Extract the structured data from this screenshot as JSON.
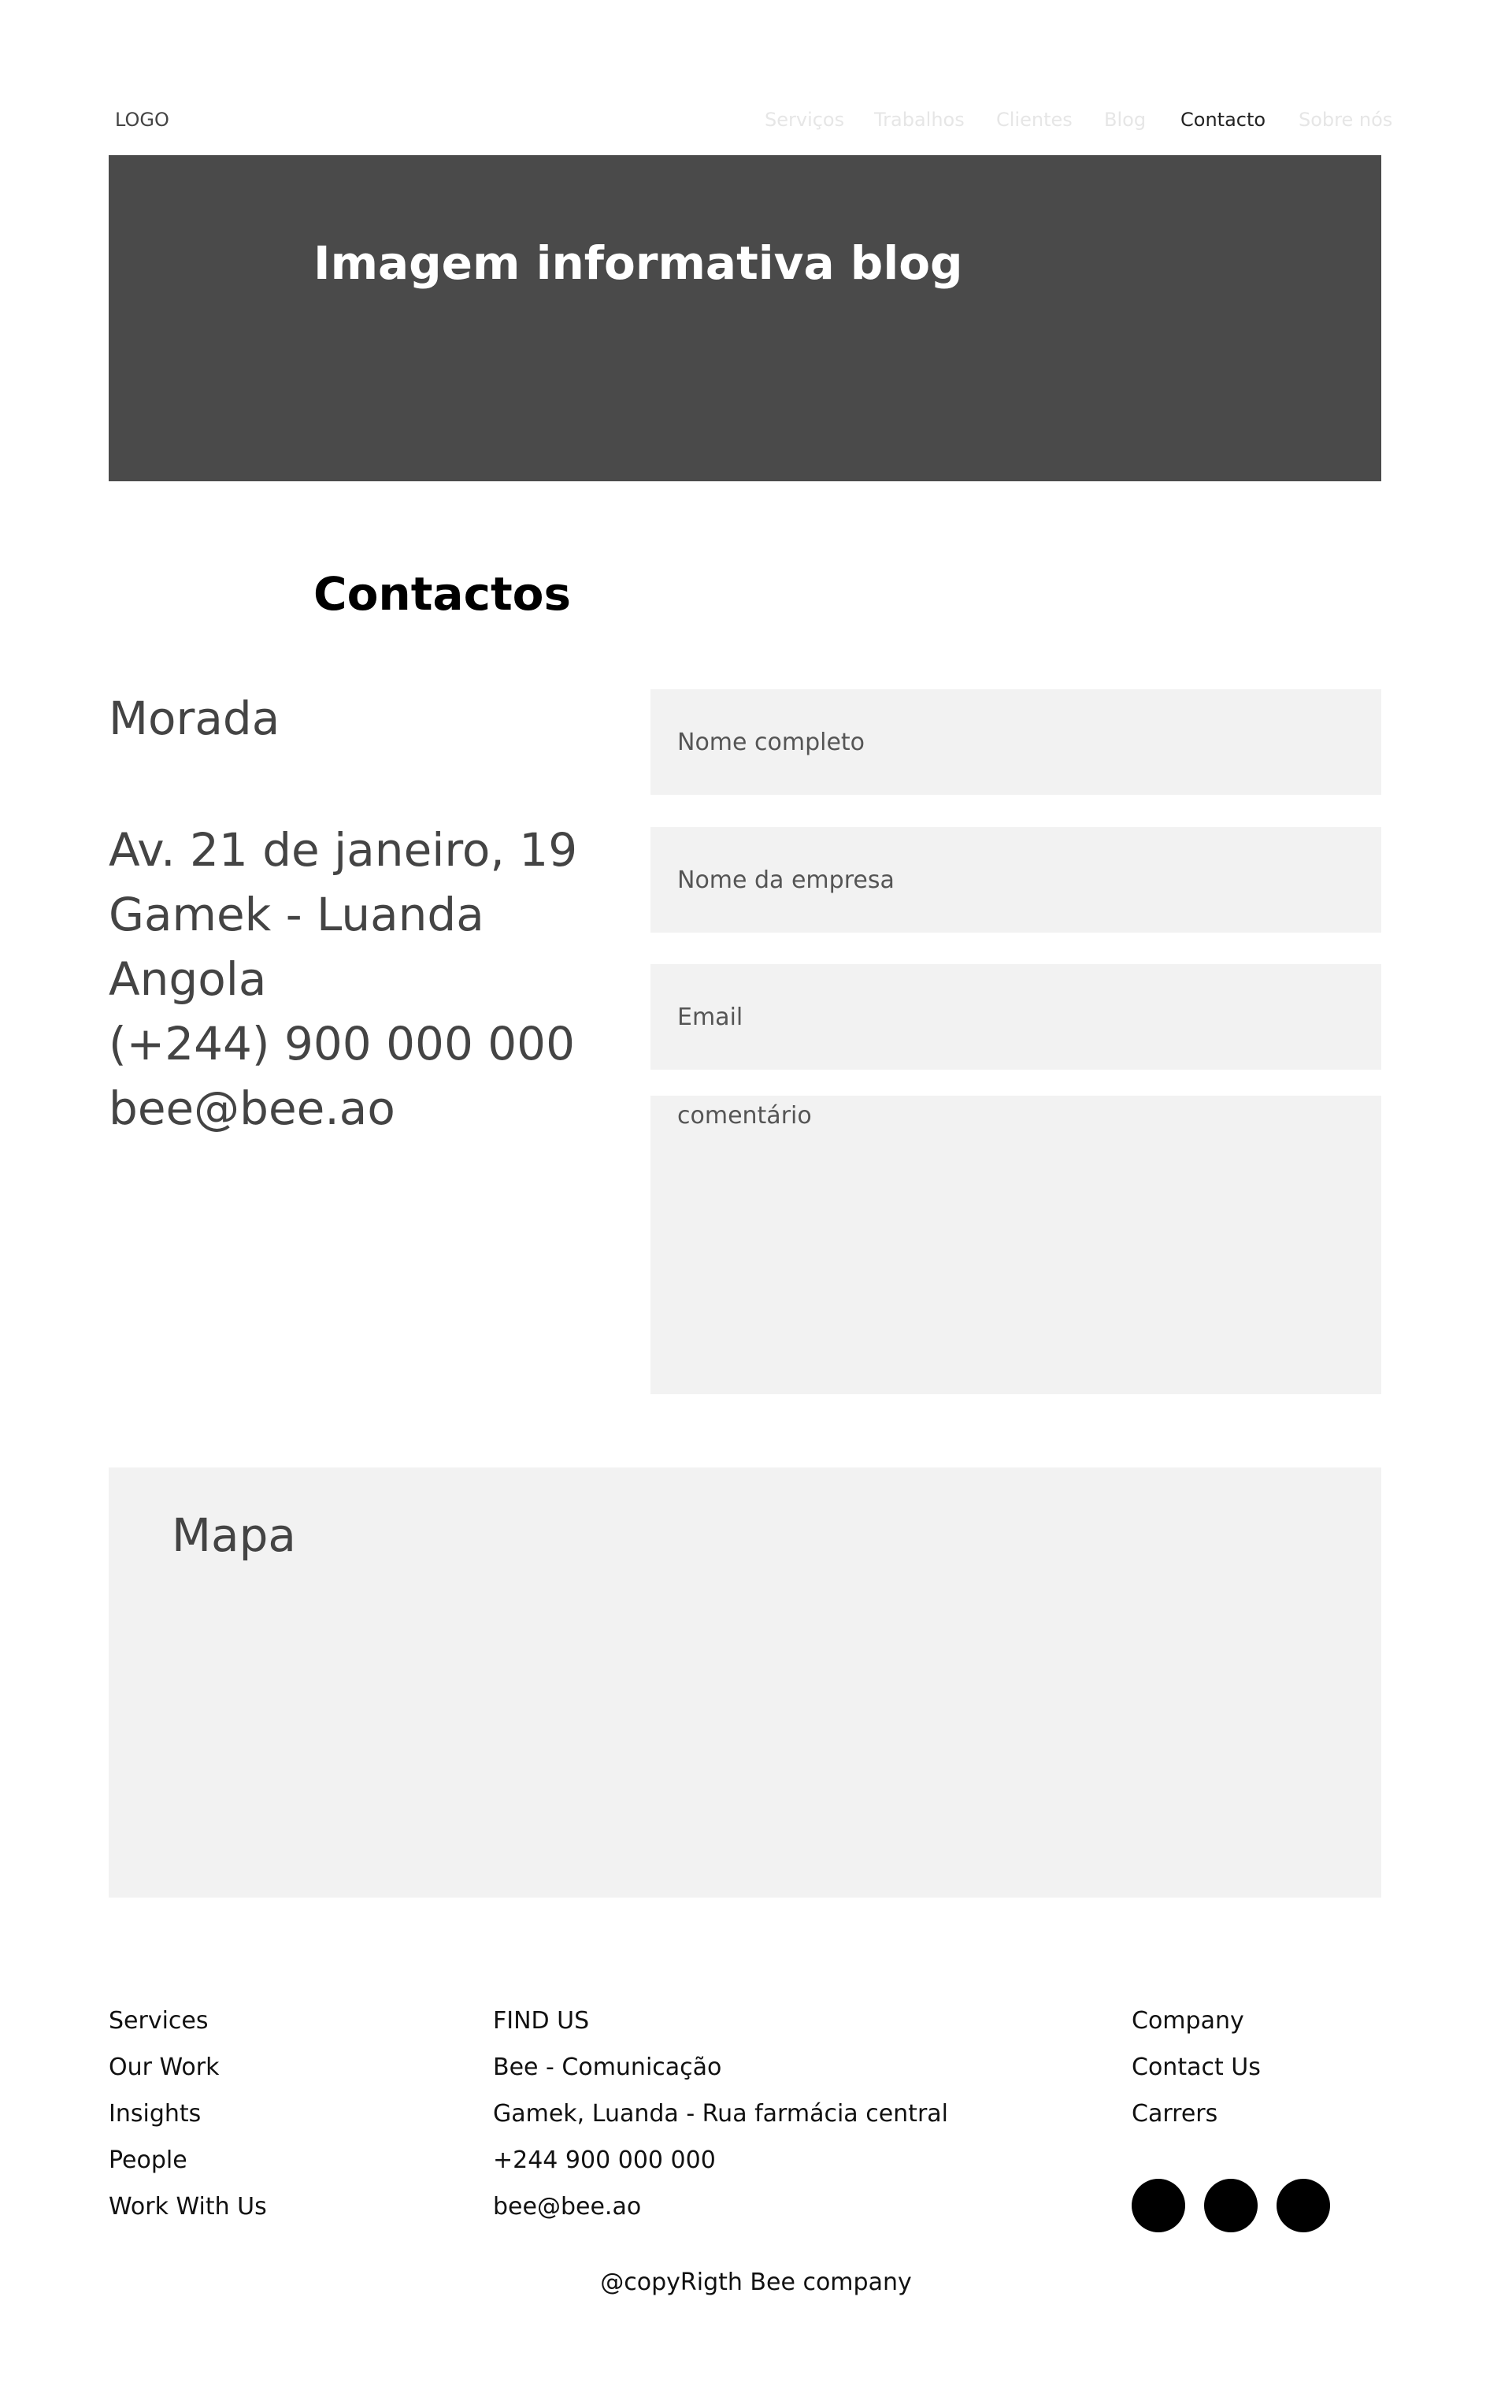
{
  "header": {
    "logo": "LOGO",
    "nav": [
      {
        "label": "Serviços",
        "active": false
      },
      {
        "label": "Trabalhos",
        "active": false
      },
      {
        "label": "Clientes",
        "active": false
      },
      {
        "label": "Blog",
        "active": false
      },
      {
        "label": "Contacto",
        "active": true
      },
      {
        "label": "Sobre nós",
        "active": false
      }
    ]
  },
  "hero": {
    "title": "Imagem informativa blog"
  },
  "contacts": {
    "title": "Contactos",
    "address_label": "Morada",
    "address_lines": [
      "Av. 21 de janeiro, 19",
      "Gamek - Luanda",
      "Angola",
      "(+244) 900 000 000",
      "bee@bee.ao"
    ]
  },
  "form": {
    "name_placeholder": "Nome completo",
    "company_placeholder": "Nome da empresa",
    "email_placeholder": "Email",
    "comment_placeholder": "comentário"
  },
  "map": {
    "label": "Mapa"
  },
  "footer": {
    "col1": [
      "Services",
      "Our Work",
      "Insights",
      "People",
      "Work With Us"
    ],
    "col2": [
      "FIND US",
      "Bee - Comunicação",
      "Gamek, Luanda - Rua farmácia central",
      "+244 900 000 000",
      "bee@bee.ao"
    ],
    "col3": [
      "Company",
      "Contact Us",
      "Carrers"
    ],
    "copyright": "@copyRigth Bee company"
  },
  "colors": {
    "hero_bg": "#4a4a4a",
    "field_bg": "#f2f2f2",
    "nav_muted": "#e6e6e6",
    "social_icon": "#000000"
  }
}
